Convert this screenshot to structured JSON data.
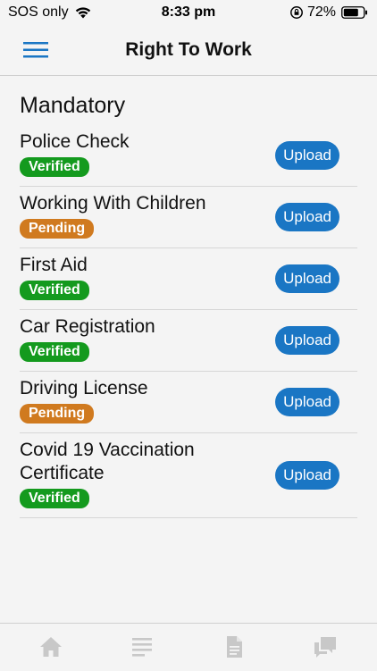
{
  "status_bar": {
    "carrier": "SOS only",
    "time": "8:33 pm",
    "battery": "72%"
  },
  "header": {
    "title": "Right To Work"
  },
  "section": {
    "title": "Mandatory"
  },
  "upload_label": "Upload",
  "documents": [
    {
      "name": "Police Check",
      "status": "Verified"
    },
    {
      "name": "Working With Children",
      "status": "Pending"
    },
    {
      "name": "First Aid",
      "status": "Verified"
    },
    {
      "name": "Car Registration",
      "status": "Verified"
    },
    {
      "name": "Driving License",
      "status": "Pending"
    },
    {
      "name": "Covid 19 Vaccination Certificate",
      "status": "Verified"
    }
  ],
  "colors": {
    "accent": "#1a76c4",
    "verified": "#149a1e",
    "pending": "#d07a1f"
  },
  "tab_bar": {
    "icons": [
      "home-icon",
      "list-icon",
      "document-icon",
      "chat-icon"
    ]
  }
}
